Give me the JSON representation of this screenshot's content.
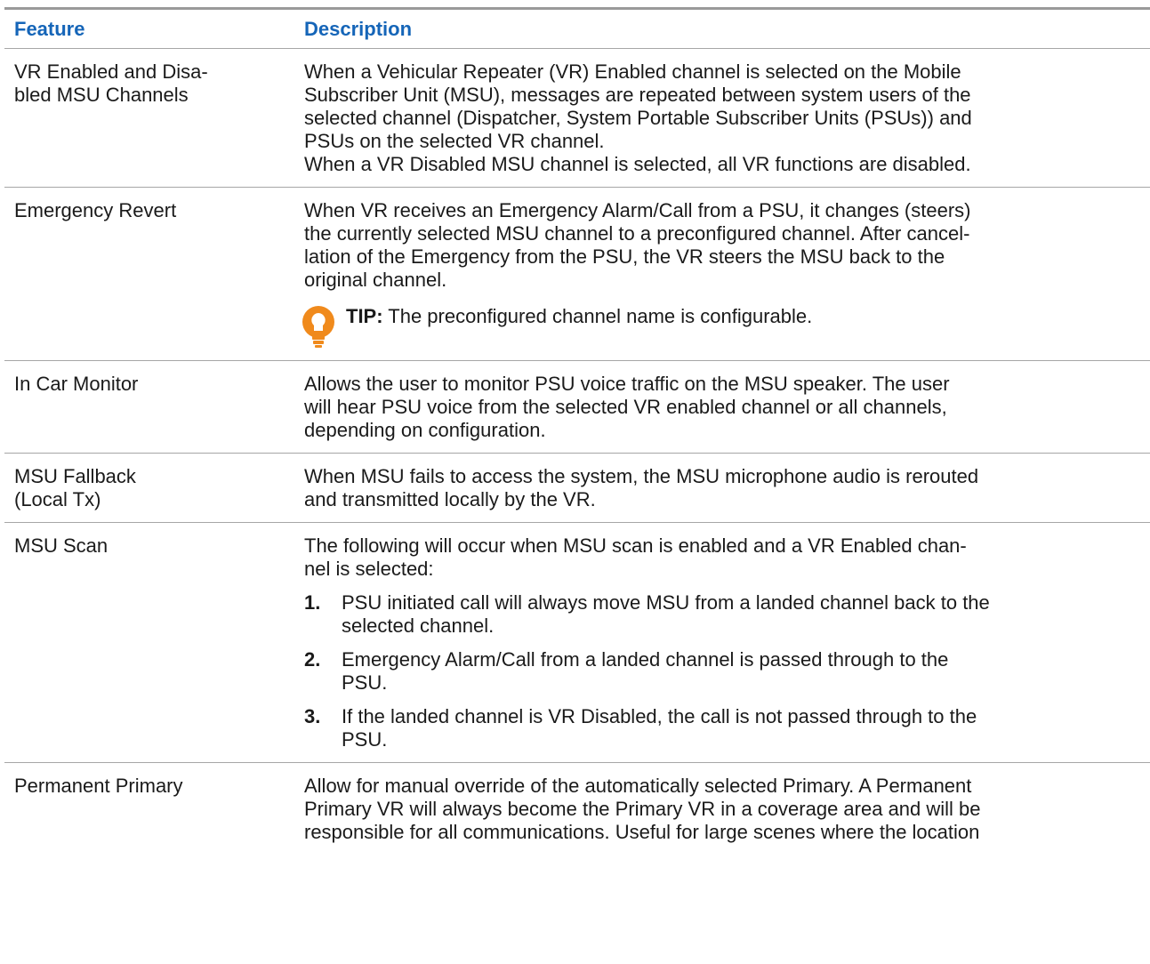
{
  "table": {
    "headers": {
      "feature": "Feature",
      "description": "Description"
    },
    "rows": [
      {
        "feature": [
          "VR Enabled and Disa-",
          "bled MSU Channels"
        ],
        "description": [
          "When a Vehicular Repeater (VR) Enabled channel is selected on the Mobile",
          "Subscriber Unit (MSU), messages are repeated between system users of the",
          "selected channel (Dispatcher, System Portable Subscriber Units (PSUs)) and",
          "PSUs on the selected VR channel.",
          "When a VR Disabled MSU channel is selected, all VR functions are disabled."
        ]
      },
      {
        "feature": [
          "Emergency Revert"
        ],
        "description": [
          "When VR receives an Emergency Alarm/Call from a PSU, it changes (steers)",
          "the currently selected MSU channel to a preconfigured channel. After cancel-",
          "lation of the Emergency from the PSU, the VR steers the MSU back to the",
          "original channel."
        ],
        "tip": {
          "label": "TIP:",
          "text": " The preconfigured channel name is configurable.",
          "icon": "lightbulb-icon",
          "color": "#f08a1c"
        }
      },
      {
        "feature": [
          "In Car Monitor"
        ],
        "description": [
          "Allows the user to monitor PSU voice traffic on the MSU speaker. The user",
          "will hear PSU voice from the selected VR enabled channel or all channels,",
          "depending on configuration."
        ]
      },
      {
        "feature": [
          "MSU Fallback",
          "(Local Tx)"
        ],
        "description": [
          "When MSU fails to access the system, the MSU microphone audio is rerouted",
          "and transmitted locally by the VR."
        ]
      },
      {
        "feature": [
          "MSU Scan"
        ],
        "intro": [
          "The following will occur when MSU scan is enabled and a VR Enabled chan-",
          "nel is selected:"
        ],
        "steps": [
          {
            "num": "1.",
            "lines": [
              "PSU initiated call will always move MSU from a landed channel back to the",
              "selected channel."
            ]
          },
          {
            "num": "2.",
            "lines": [
              "Emergency Alarm/Call from a landed channel is passed through to the",
              "PSU."
            ]
          },
          {
            "num": "3.",
            "lines": [
              "If the landed channel is VR Disabled, the call is not passed through to the",
              "PSU."
            ]
          }
        ]
      },
      {
        "feature": [
          "Permanent Primary"
        ],
        "description": [
          "Allow for manual override of the automatically selected Primary. A Permanent",
          "Primary VR will always become the Primary VR in a coverage area and will be",
          "responsible for all communications. Useful for large scenes where the location"
        ]
      }
    ]
  },
  "colors": {
    "header_text": "#1565b8",
    "rule": "#9a9a9a",
    "tip_icon": "#f08a1c"
  }
}
